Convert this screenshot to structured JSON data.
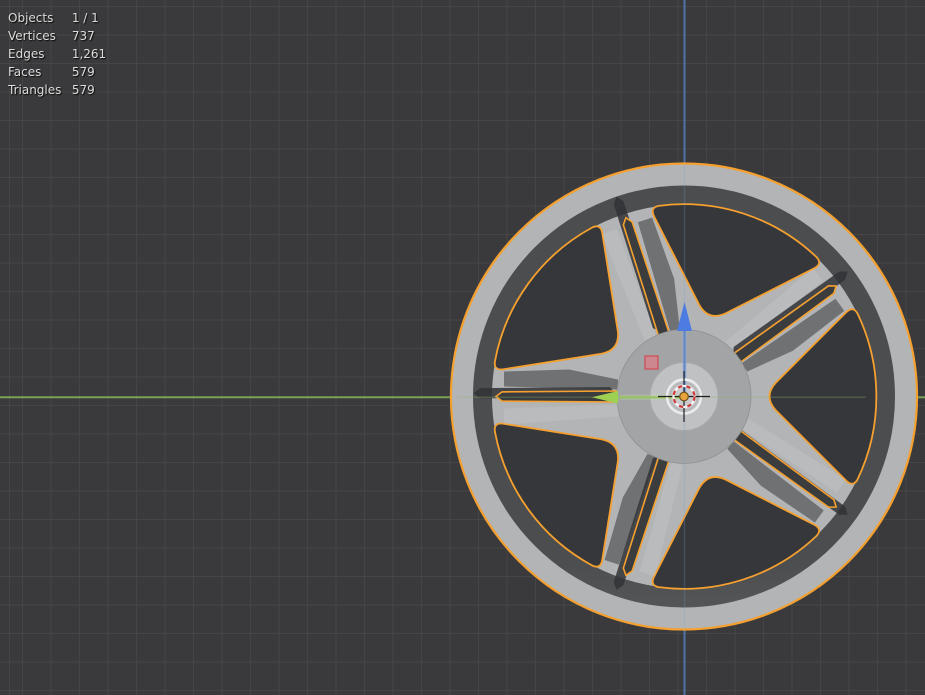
{
  "viewport": {
    "stats": {
      "rows": [
        {
          "label": "Objects",
          "value": "1 / 1"
        },
        {
          "label": "Vertices",
          "value": "737"
        },
        {
          "label": "Edges",
          "value": "1,261"
        },
        {
          "label": "Faces",
          "value": "579"
        },
        {
          "label": "Triangles",
          "value": "579"
        }
      ]
    },
    "colors": {
      "background": "#3a3a3c",
      "grid": "#454546",
      "outline": "#f5a02f",
      "wheel_light": "#b2b4b6",
      "opening_dark": "#44464a",
      "axis_y": "#79a257",
      "axis_z": "#4f74a8",
      "gizmo_green": "#9ed153",
      "gizmo_blue": "#4c7ce2",
      "plane_handle_red": "#d24d59",
      "cursor_red": "#cf3b3b",
      "cursor_white": "#ededed",
      "origin_orange": "#e8a33c",
      "stats_text": "#dcdcdc"
    },
    "scene_object": {
      "type": "wheel-rim-mesh",
      "spoke_pairs": 5,
      "selected": true
    }
  }
}
